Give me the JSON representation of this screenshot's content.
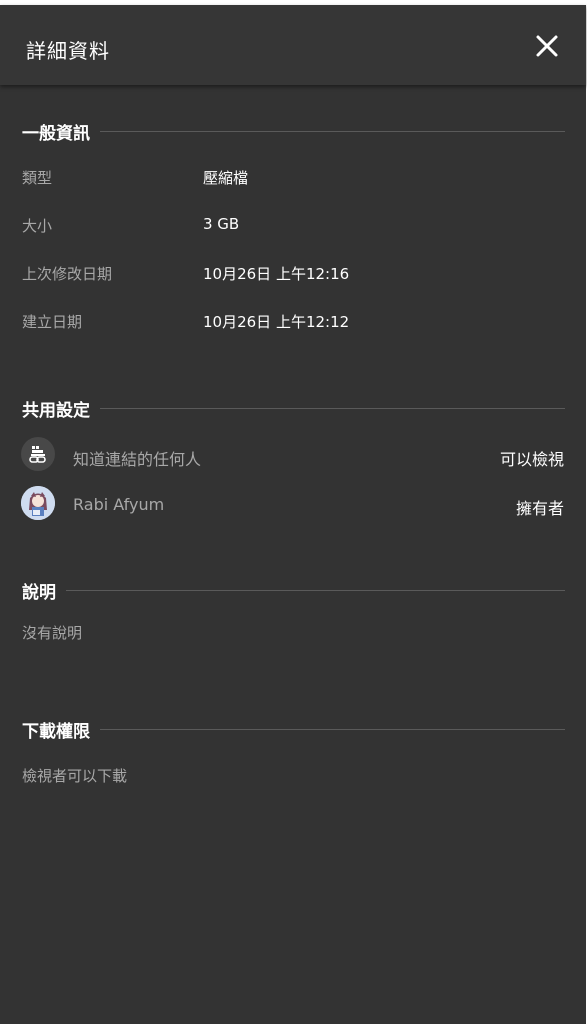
{
  "header": {
    "title": "詳細資料",
    "close_icon": "close-icon"
  },
  "general": {
    "title": "一般資訊",
    "rows": [
      {
        "label": "類型",
        "value": "壓縮檔"
      },
      {
        "label": "大小",
        "value": "3 GB"
      },
      {
        "label": "上次修改日期",
        "value": "10月26日 上午12:16"
      },
      {
        "label": "建立日期",
        "value": "10月26日 上午12:12"
      }
    ]
  },
  "sharing": {
    "title": "共用設定",
    "entries": [
      {
        "name": "知道連結的任何人",
        "role": "可以檢視",
        "icon": "link-group-icon"
      },
      {
        "name": "Rabi Afyum",
        "role": "擁有者",
        "icon": "user-avatar"
      }
    ]
  },
  "description": {
    "title": "說明",
    "text": "沒有說明"
  },
  "download": {
    "title": "下載權限",
    "text": "檢視者可以下載"
  },
  "colors": {
    "panel_bg": "#333333",
    "header_bg": "#363636",
    "label_gray": "#a8a8a8",
    "text_white": "#ffffff"
  }
}
